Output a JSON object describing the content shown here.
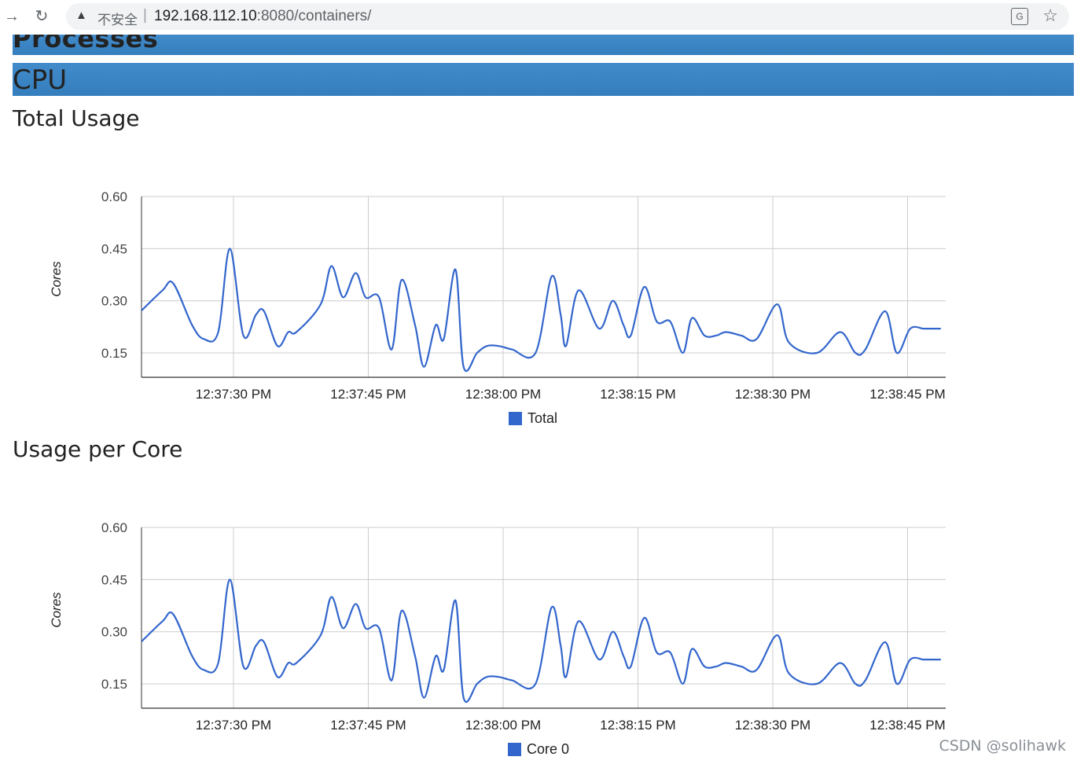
{
  "browser": {
    "security_label": "不安全",
    "separator": "|",
    "url_host": "192.168.112.10",
    "url_path": ":8080/containers/"
  },
  "sections": {
    "processes_title": "Processes",
    "cpu_title": "CPU"
  },
  "total_usage": {
    "heading": "Total Usage"
  },
  "per_core": {
    "heading": "Usage per Core"
  },
  "watermark": "CSDN @solihawk",
  "chart_data": [
    {
      "type": "line",
      "title": "Total Usage",
      "ylabel": "Cores",
      "ylim": [
        0.08,
        0.6
      ],
      "yticks": [
        0.15,
        0.3,
        0.45,
        0.6
      ],
      "ytick_labels": [
        "0.15",
        "0.30",
        "0.45",
        "0.60"
      ],
      "xlim": [
        20,
        50
      ],
      "xticks": [
        30,
        45,
        60,
        75,
        90,
        105
      ],
      "xtick_labels": [
        "12:37:30 PM",
        "12:37:45 PM",
        "12:38:00 PM",
        "12:38:15 PM",
        "12:38:30 PM",
        "12:38:45 PM"
      ],
      "grid": true,
      "legend": "bottom",
      "series": [
        {
          "name": "Total",
          "color": "#3366cc",
          "x": [
            19.7,
            22.1,
            23.3,
            25.4,
            26.7,
            28.3,
            29.6,
            31.1,
            32.5,
            33.4,
            34.9,
            36.1,
            37.0,
            39.7,
            40.9,
            42.2,
            43.6,
            44.7,
            46.2,
            47.6,
            48.7,
            50.2,
            51.2,
            52.5,
            53.4,
            54.7,
            55.6,
            57.1,
            58.2,
            59.5,
            61.0,
            63.6,
            65.4,
            66.4,
            67.0,
            68.4,
            70.7,
            72.2,
            73.4,
            74.2,
            75.7,
            77.1,
            78.6,
            80.0,
            81.0,
            82.4,
            83.7,
            84.8,
            86.5,
            88.2,
            90.5,
            91.8,
            94.9,
            97.5,
            99.2,
            100.3,
            102.5,
            103.8,
            105.3,
            106.8,
            107.9,
            108.7
          ],
          "y": [
            0.27,
            0.33,
            0.35,
            0.23,
            0.19,
            0.21,
            0.45,
            0.2,
            0.26,
            0.27,
            0.17,
            0.21,
            0.21,
            0.29,
            0.4,
            0.31,
            0.38,
            0.31,
            0.31,
            0.16,
            0.36,
            0.23,
            0.11,
            0.23,
            0.19,
            0.39,
            0.11,
            0.15,
            0.17,
            0.17,
            0.16,
            0.15,
            0.37,
            0.26,
            0.17,
            0.33,
            0.22,
            0.3,
            0.23,
            0.2,
            0.34,
            0.24,
            0.24,
            0.15,
            0.25,
            0.2,
            0.2,
            0.21,
            0.2,
            0.19,
            0.29,
            0.18,
            0.15,
            0.21,
            0.15,
            0.16,
            0.27,
            0.15,
            0.22,
            0.22,
            0.22,
            0.22
          ]
        }
      ]
    },
    {
      "type": "line",
      "title": "Usage per Core",
      "ylabel": "Cores",
      "ylim": [
        0.08,
        0.6
      ],
      "yticks": [
        0.15,
        0.3,
        0.45,
        0.6
      ],
      "ytick_labels": [
        "0.15",
        "0.30",
        "0.45",
        "0.60"
      ],
      "xlim": [
        20,
        50
      ],
      "xticks": [
        30,
        45,
        60,
        75,
        90,
        105
      ],
      "xtick_labels": [
        "12:37:30 PM",
        "12:37:45 PM",
        "12:38:00 PM",
        "12:38:15 PM",
        "12:38:30 PM",
        "12:38:45 PM"
      ],
      "grid": true,
      "legend": "bottom",
      "series": [
        {
          "name": "Core 0",
          "color": "#3366cc",
          "x": [
            19.7,
            22.1,
            23.3,
            25.4,
            26.7,
            28.3,
            29.6,
            31.1,
            32.5,
            33.4,
            34.9,
            36.1,
            37.0,
            39.7,
            40.9,
            42.2,
            43.6,
            44.7,
            46.2,
            47.6,
            48.7,
            50.2,
            51.2,
            52.5,
            53.4,
            54.7,
            55.6,
            57.1,
            58.2,
            59.5,
            61.0,
            63.6,
            65.4,
            66.4,
            67.0,
            68.4,
            70.7,
            72.2,
            73.4,
            74.2,
            75.7,
            77.1,
            78.6,
            80.0,
            81.0,
            82.4,
            83.7,
            84.8,
            86.5,
            88.2,
            90.5,
            91.8,
            94.9,
            97.5,
            99.2,
            100.3,
            102.5,
            103.8,
            105.3,
            106.8,
            107.9,
            108.7
          ],
          "y": [
            0.27,
            0.33,
            0.35,
            0.23,
            0.19,
            0.21,
            0.45,
            0.2,
            0.26,
            0.27,
            0.17,
            0.21,
            0.21,
            0.29,
            0.4,
            0.31,
            0.38,
            0.31,
            0.31,
            0.16,
            0.36,
            0.23,
            0.11,
            0.23,
            0.19,
            0.39,
            0.11,
            0.15,
            0.17,
            0.17,
            0.16,
            0.15,
            0.37,
            0.26,
            0.17,
            0.33,
            0.22,
            0.3,
            0.23,
            0.2,
            0.34,
            0.24,
            0.24,
            0.15,
            0.25,
            0.2,
            0.2,
            0.21,
            0.2,
            0.19,
            0.29,
            0.18,
            0.15,
            0.21,
            0.15,
            0.16,
            0.27,
            0.15,
            0.22,
            0.22,
            0.22,
            0.22
          ]
        }
      ]
    }
  ]
}
